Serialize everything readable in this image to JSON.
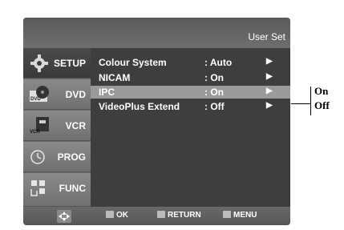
{
  "header": {
    "title": "User Set"
  },
  "sidebar": {
    "tabs": [
      {
        "label": "SETUP",
        "icon": "gear-icon",
        "active": true
      },
      {
        "label": "DVD",
        "icon": "dvd-icon",
        "active": false
      },
      {
        "label": "VCR",
        "icon": "vcr-icon",
        "active": false
      },
      {
        "label": "PROG",
        "icon": "clock-icon",
        "active": false
      },
      {
        "label": "FUNC",
        "icon": "function-icon",
        "active": false
      }
    ]
  },
  "menu": {
    "rows": [
      {
        "label": "Colour System",
        "value": ": Auto",
        "arrow": "▶"
      },
      {
        "label": "NICAM",
        "value": ": On",
        "arrow": "▶"
      },
      {
        "label": "IPC",
        "value": ": On",
        "arrow": "▶",
        "highlighted": true
      },
      {
        "label": "VideoPlus Extend",
        "value": ": Off",
        "arrow": "▶"
      }
    ]
  },
  "footer": {
    "ok_label": "OK",
    "return_label": "RETURN",
    "menu_label": "MENU"
  },
  "callout": {
    "options": [
      "On",
      "Off"
    ]
  },
  "colors": {
    "highlight": "#9a9a9a",
    "content_bg": "#3e3e3e",
    "active_tab": "#3a3a3a"
  }
}
